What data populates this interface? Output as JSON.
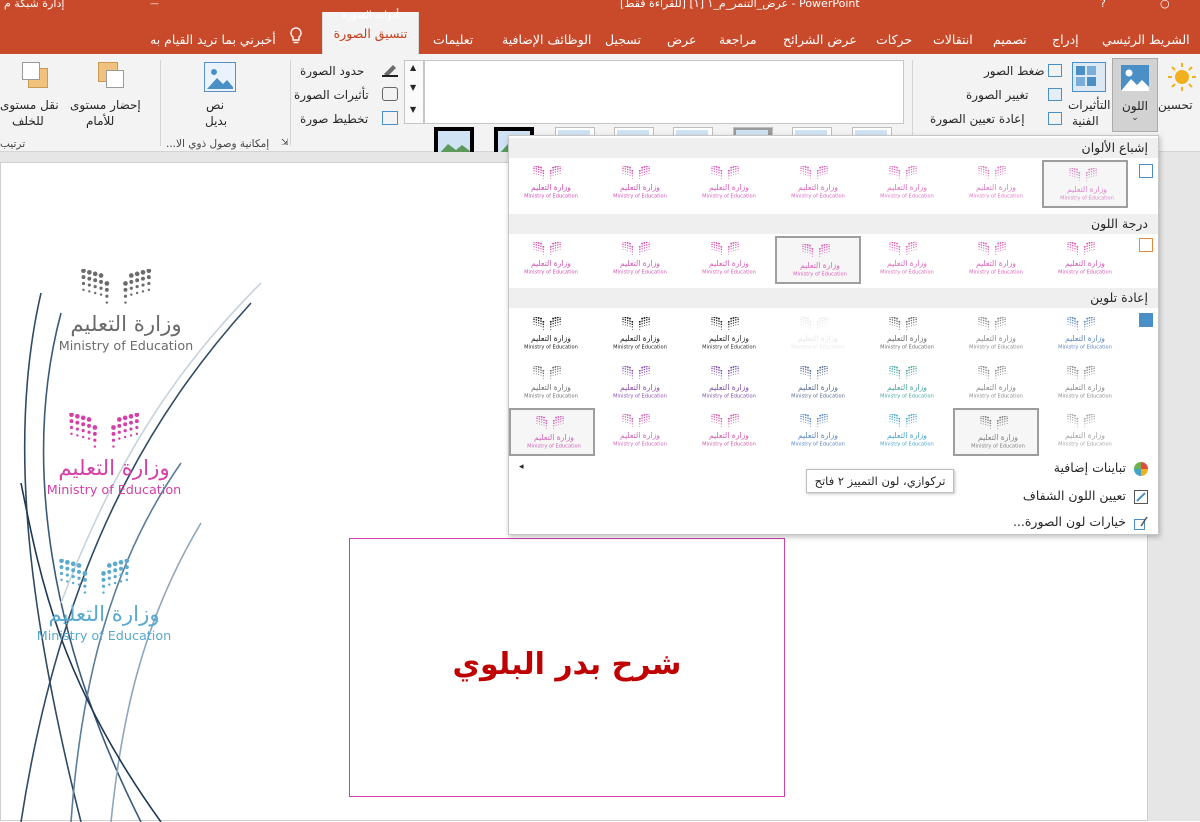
{
  "titlebar": {
    "filename": "عرض_التنمر_م_١ [١] [للقراءة فقط] - PowerPoint",
    "network_label": "إدارة شبكة م",
    "picture_tools": "أدوات الصورة"
  },
  "tabs": [
    "الشريط الرئيسي",
    "إدراج",
    "تصميم",
    "انتقالات",
    "حركات",
    "عرض الشرائح",
    "مراجعة",
    "عرض",
    "تسجيل",
    "الوظائف الإضافية",
    "تعليمات"
  ],
  "active_tab": "تنسيق الصورة",
  "tell_me": "أخبرني بما تريد القيام به",
  "ribbon": {
    "corrections": "تحسين",
    "color": "اللون",
    "artistic_1": "التأثيرات",
    "artistic_2": "الفنية",
    "compress": "ضغط الصور",
    "change": "تغيير الصورة",
    "reset": "إعادة تعيين الصورة",
    "border": "حدود الصورة",
    "effects": "تأثيرات الصورة",
    "layout": "تخطيط صورة",
    "alt_1": "نص",
    "alt_2": "بديل",
    "access_group": "إمكانية وصول ذوي الا...",
    "forward_1": "إحضار مستوى",
    "forward_2": "للأمام",
    "backward_1": "نقل مستوى",
    "backward_2": "للخلف",
    "arrange_group": "ترتيب"
  },
  "dropdown": {
    "saturation": "إشباع الألوان",
    "tone": "درجة اللون",
    "recolor": "إعادة تلوين",
    "more_variations": "تباينات إضافية",
    "set_transparent": "تعيين اللون الشفاف",
    "color_options": "خيارات لون الصورة...",
    "tooltip": "تركوازي، لون التمييز ٢ فاتح",
    "logo_ar": "وزارة التعليم",
    "logo_en": "Ministry of Education"
  },
  "slide": {
    "logo_ar": "وزارة التعليم",
    "logo_en": "Ministry of Education",
    "title": "شرح بدر البلوي"
  },
  "colors": {
    "accent": "#c84a2b",
    "title_red": "#c00000",
    "pink": "#d63fa8",
    "teal": "#3fa6c9"
  }
}
